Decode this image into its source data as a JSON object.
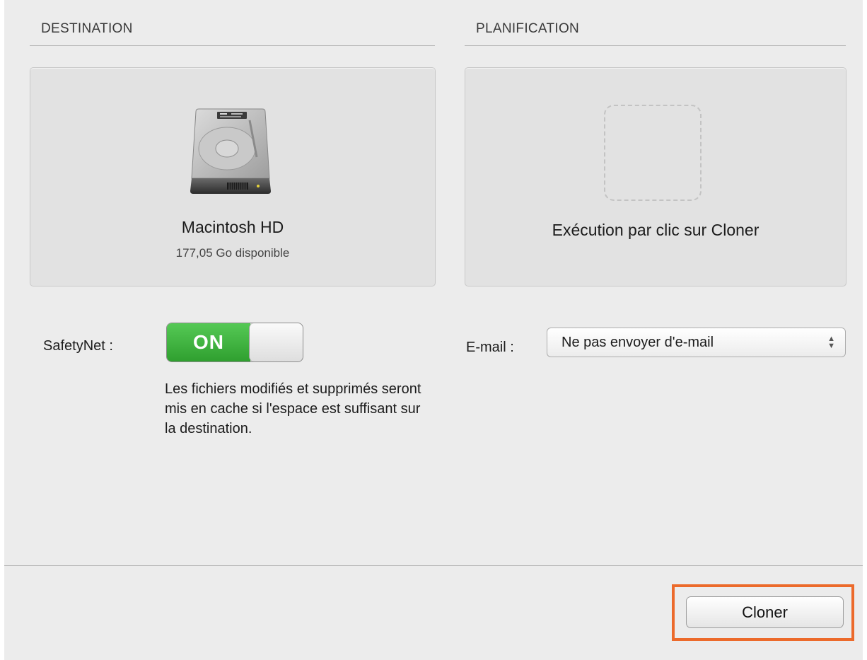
{
  "destination": {
    "header": "DESTINATION",
    "icon": "hard-drive-icon",
    "disk_name": "Macintosh HD",
    "disk_space": "177,05 Go disponible",
    "safetynet": {
      "label": "SafetyNet :",
      "state": "ON",
      "description": "Les fichiers modifiés et supprimés seront mis en cache si l'espace est suffisant sur la destination."
    }
  },
  "schedule": {
    "header": "PLANIFICATION",
    "run_label": "Exécution par clic sur Cloner",
    "email": {
      "label": "E-mail :",
      "selected": "Ne pas envoyer d'e-mail"
    }
  },
  "footer": {
    "clone_label": "Cloner",
    "highlight_color": "#ec6a2b"
  },
  "colors": {
    "toggle_on": "#3fb33f",
    "background": "#ececec"
  }
}
